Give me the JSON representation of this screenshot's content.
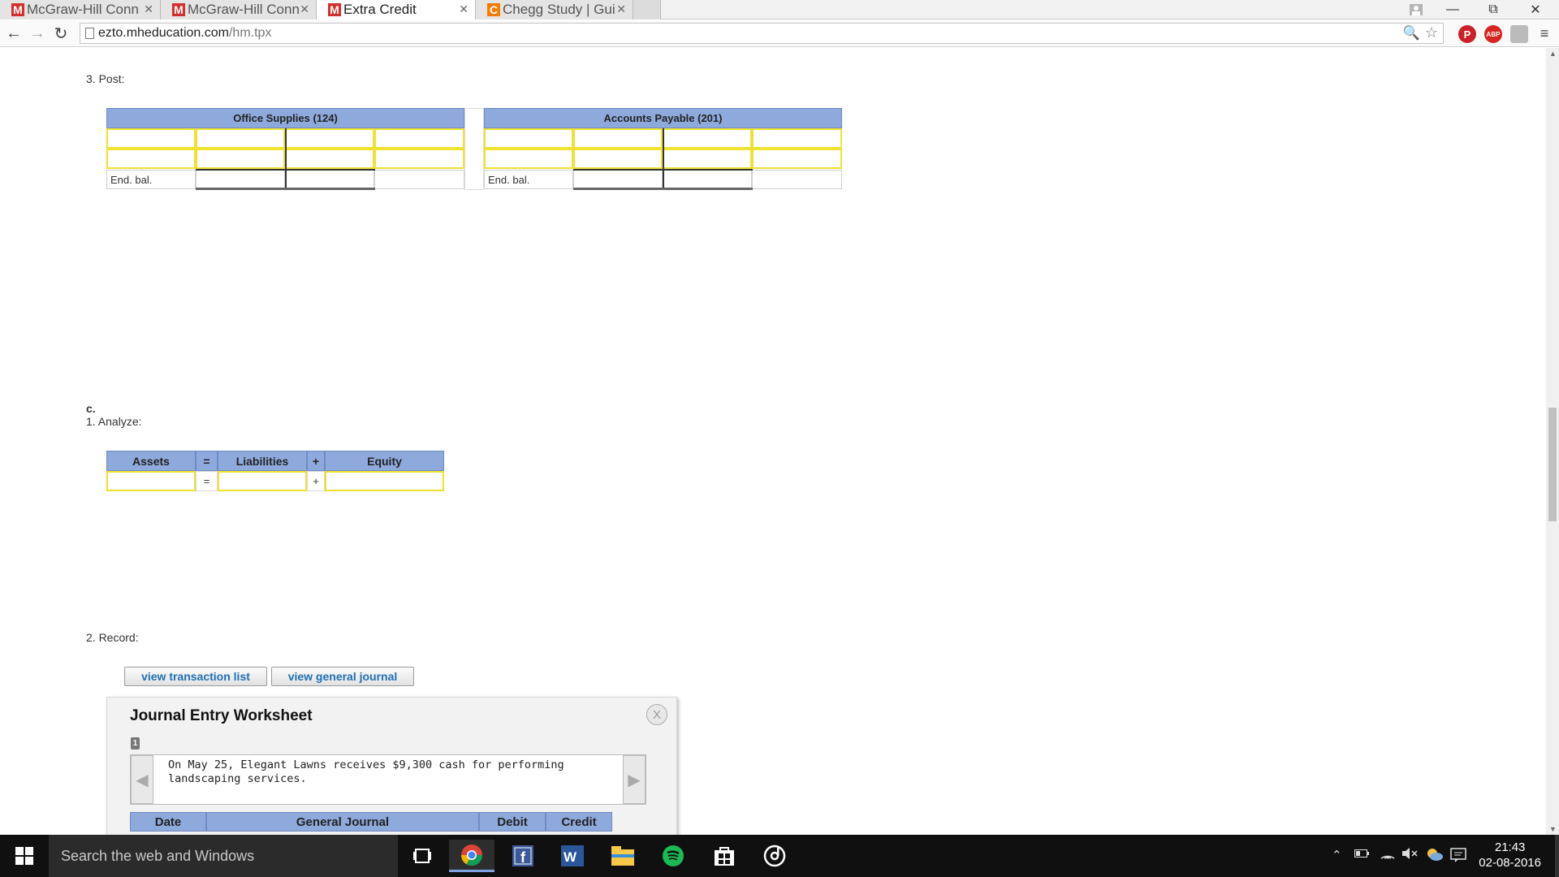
{
  "browser": {
    "tabs": [
      {
        "label": "McGraw-Hill Conn",
        "icon": "M"
      },
      {
        "label": "McGraw-Hill Conn",
        "icon": "M"
      },
      {
        "label": "Extra Credit",
        "icon": "M"
      },
      {
        "label": "Chegg Study | Gui",
        "icon": "C"
      }
    ],
    "url_host": "ezto.mheducation.com",
    "url_path": "/hm.tpx",
    "ext_abp": "ABP"
  },
  "section_b": {
    "step3_label": "3.  Post:",
    "account1_title": "Office Supplies (124)",
    "account2_title": "Accounts Payable (201)",
    "end_bal_label": "End. bal."
  },
  "section_c": {
    "letter": "c.",
    "step1_label": "1.  Analyze:",
    "headers": {
      "assets": "Assets",
      "eq": "=",
      "liabilities": "Liabilities",
      "plus": "+",
      "equity": "Equity"
    },
    "eq_symbol": "=",
    "plus_symbol": "+",
    "step2_label": "2.  Record:",
    "btn_transactions": "view transaction list",
    "btn_journal": "view general journal"
  },
  "worksheet": {
    "title": "Journal Entry Worksheet",
    "close_label": "X",
    "entry_number": "1",
    "description": "On May 25, Elegant Lawns receives $9,300 cash for performing landscaping services.",
    "col_date": "Date",
    "col_general_journal": "General Journal",
    "col_debit": "Debit",
    "col_credit": "Credit"
  },
  "taskbar": {
    "search_placeholder": "Search the web and Windows",
    "time": "21:43",
    "date": "02-08-2016"
  },
  "colors": {
    "table_header": "#8ea9db",
    "input_border": "#f0e230",
    "link_blue": "#1f6fb5",
    "mh_red": "#d32f2f",
    "chegg_orange": "#f57c00"
  }
}
